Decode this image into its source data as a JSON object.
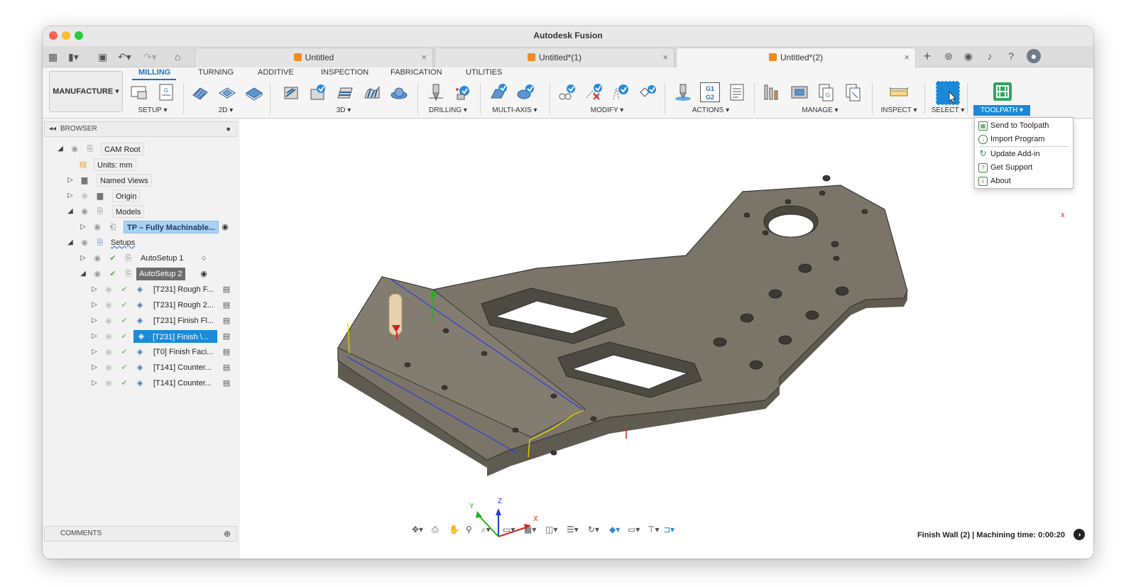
{
  "window": {
    "title": "Autodesk Fusion"
  },
  "tabs": [
    {
      "label": "Untitled",
      "active": false
    },
    {
      "label": "Untitled*(1)",
      "active": false
    },
    {
      "label": "Untitled*(2)",
      "active": true
    }
  ],
  "ribbon": {
    "workspace": "MANUFACTURE",
    "tabs": [
      "MILLING",
      "TURNING",
      "ADDITIVE",
      "INSPECTION",
      "FABRICATION",
      "UTILITIES"
    ],
    "groups": [
      "SETUP ▾",
      "2D ▾",
      "3D ▾",
      "DRILLING ▾",
      "MULTI-AXIS ▾",
      "MODIFY ▾",
      "ACTIONS ▾",
      "MANAGE ▾",
      "INSPECT ▾",
      "SELECT ▾",
      "TOOLPATH ▾"
    ],
    "g1g2": "G1\nG2"
  },
  "browser": {
    "title": "BROWSER",
    "items": [
      {
        "label": "CAM Root"
      },
      {
        "label": "Units: mm"
      },
      {
        "label": "Named Views"
      },
      {
        "label": "Origin"
      },
      {
        "label": "Models"
      },
      {
        "label": "TP – Fully Machinable..."
      },
      {
        "label": "Setups"
      },
      {
        "label": "AutoSetup 1"
      },
      {
        "label": "AutoSetup 2"
      },
      {
        "label": "[T231] Rough F..."
      },
      {
        "label": "[T231] Rough 2..."
      },
      {
        "label": "[T231] Finish Fl..."
      },
      {
        "label": "[T231] Finish \\..."
      },
      {
        "label": "[T0] Finish Faci..."
      },
      {
        "label": "[T141] Counter..."
      },
      {
        "label": "[T141] Counter..."
      }
    ]
  },
  "comments": {
    "label": "COMMENTS"
  },
  "menu": {
    "items": [
      "Send to Toolpath",
      "Import Program",
      "Update Add-in",
      "Get Support",
      "About"
    ]
  },
  "status": {
    "text": "Finish Wall (2) | Machining time: 0:00:20"
  },
  "triad": {
    "x": "X",
    "y": "Y",
    "z": "Z"
  },
  "colors": {
    "accent": "#1a8ad8",
    "part": "#7a7568",
    "tab_active": "#1a73c8"
  }
}
